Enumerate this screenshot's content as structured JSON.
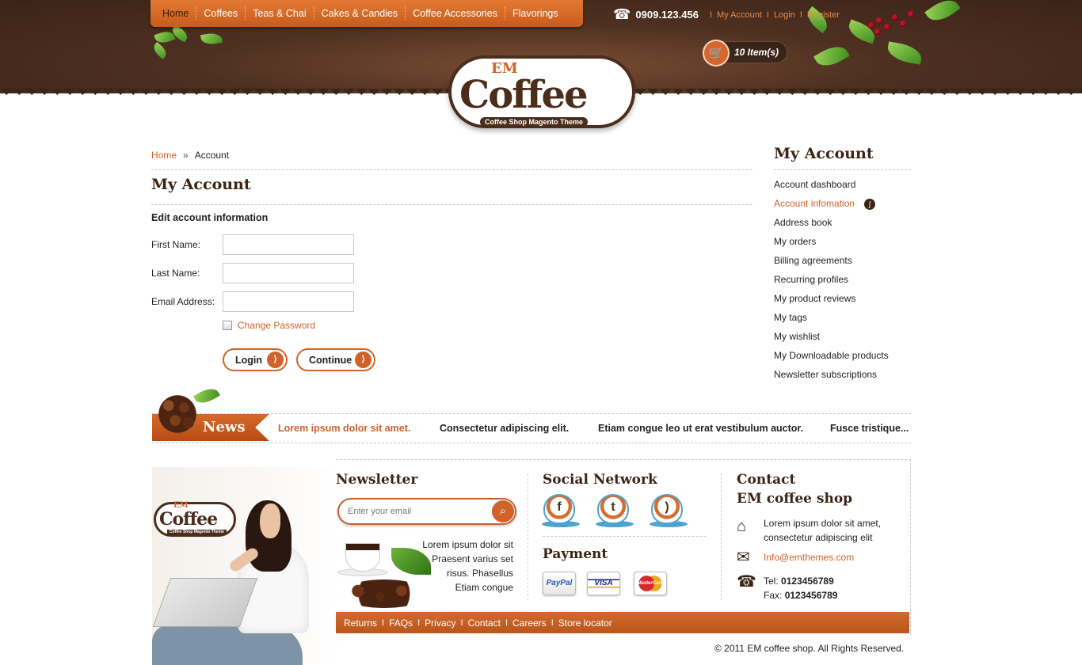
{
  "nav": {
    "items": [
      "Home",
      "Coffees",
      "Teas & Chai",
      "Cakes & Candies",
      "Coffee Accessories",
      "Flavorings"
    ],
    "active": "Home"
  },
  "toplinks": {
    "phone": "0909.123.456",
    "my_account": "My Account",
    "login": "Login",
    "register": "Register"
  },
  "cart": {
    "label": "10 Item(s)"
  },
  "logo": {
    "em": "EM",
    "main": "Coffee",
    "tagline": "Coffee Shop Magento Theme"
  },
  "breadcrumb": {
    "home": "Home",
    "current": "Account",
    "separator": "»"
  },
  "page": {
    "title": "My Account",
    "section_title": "Edit account information",
    "fields": {
      "first_name": {
        "label": "First Name:",
        "value": ""
      },
      "last_name": {
        "label": "Last Name:",
        "value": ""
      },
      "email": {
        "label": "Email Address:",
        "value": ""
      }
    },
    "change_password": "Change Password",
    "login_button": "Login",
    "continue_button": "Continue"
  },
  "sidebar": {
    "title": "My Account",
    "items": [
      {
        "label": "Account dashboard"
      },
      {
        "label": "Account infomation"
      },
      {
        "label": "Address book"
      },
      {
        "label": "My orders"
      },
      {
        "label": "Billing agreements"
      },
      {
        "label": "Recurring profiles"
      },
      {
        "label": "My product reviews"
      },
      {
        "label": "My tags"
      },
      {
        "label": "My wishlist"
      },
      {
        "label": "My Downloadable products"
      },
      {
        "label": "Newsletter subscriptions"
      }
    ],
    "active_index": 1
  },
  "news": {
    "label": "News",
    "items": [
      "Lorem ipsum dolor sit amet.",
      "Consectetur adipiscing elit.",
      "Etiam congue leo ut erat vestibulum auctor.",
      "Fusce tristique..."
    ]
  },
  "footer": {
    "logo": {
      "em": "EM",
      "main": "Coffee",
      "tagline": "Coffee Shop Magento Theme"
    },
    "newsletter": {
      "title": "Newsletter",
      "placeholder": "Enter your email",
      "text": [
        "Lorem ipsum dolor sit",
        "Praesent varius set",
        "risus. Phasellus",
        "Etiam congue"
      ]
    },
    "social": {
      "title": "Social Network",
      "icons": [
        "facebook-icon",
        "twitter-icon",
        "rss-icon"
      ]
    },
    "payment": {
      "title": "Payment",
      "methods": [
        "PayPal",
        "VISA",
        "MasterCard"
      ]
    },
    "contact": {
      "title_line1": "Contact",
      "title_line2": "EM coffee shop",
      "address_line1": "Lorem ipsum dolor sit amet,",
      "address_line2": "consectetur adipiscing elit",
      "email": "Info@emthemes.com",
      "tel_label": "Tel:",
      "tel": "0123456789",
      "fax_label": "Fax:",
      "fax": "0123456789"
    },
    "links": [
      "Returns",
      "FAQs",
      "Privacy",
      "Contact",
      "Careers",
      "Store locator"
    ],
    "copyright": "© 2011 EM coffee shop. All Rights Reserved."
  },
  "colors": {
    "accent": "#d0622a",
    "brown": "#3a2416",
    "header": "#4e3021"
  }
}
